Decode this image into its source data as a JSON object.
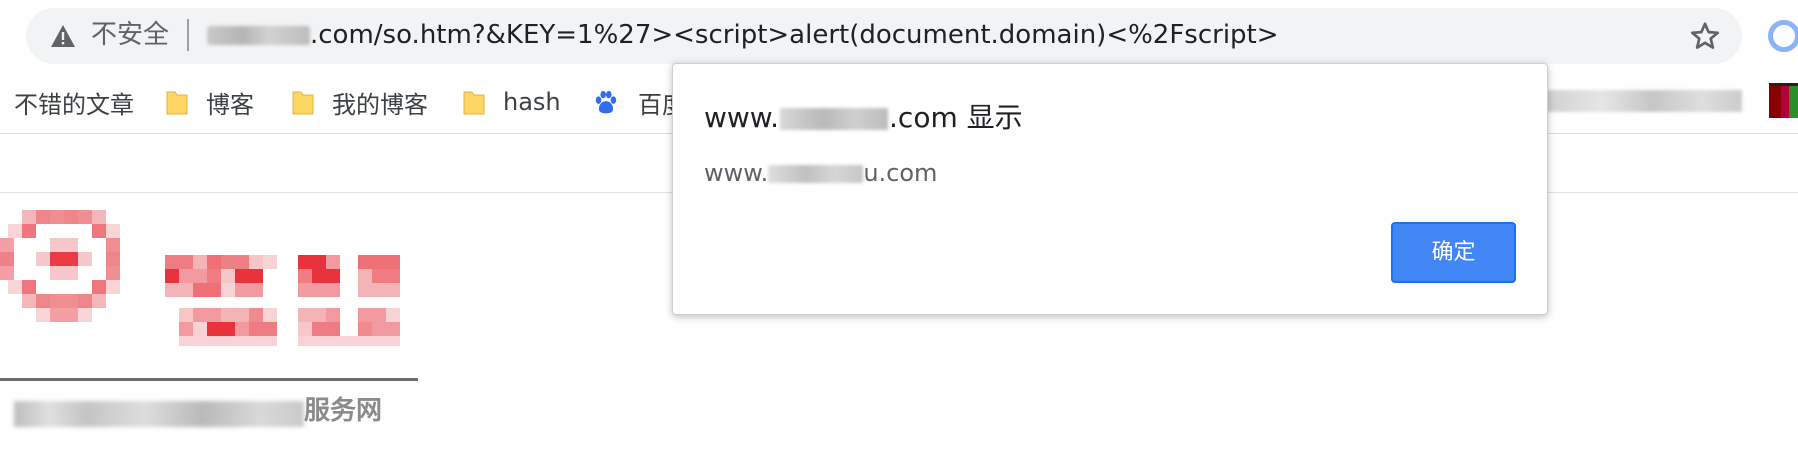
{
  "browser": {
    "security_label": "不安全",
    "url_visible": ".com/so.htm?&KEY=1%27><script>alert(document.domain)<%2Fscript>",
    "bookmarks": [
      {
        "label": "不错的文章",
        "icon": "none"
      },
      {
        "label": "博客",
        "icon": "folder-icon"
      },
      {
        "label": "我的博客",
        "icon": "folder-icon"
      },
      {
        "label": "hash",
        "icon": "folder-icon"
      },
      {
        "label": "百度",
        "icon": "baidu-icon"
      }
    ]
  },
  "dialog": {
    "title_prefix": "www.",
    "title_suffix": ".com 显示",
    "message_prefix": "www.",
    "message_suffix": "u.com",
    "ok_label": "确定"
  },
  "page": {
    "logo_subtitle": "服务网"
  },
  "colors": {
    "ok_button": "#4285f4",
    "folder": "#fdd663",
    "baidu": "#2e6ee8",
    "logo_red": "#e8323c"
  }
}
